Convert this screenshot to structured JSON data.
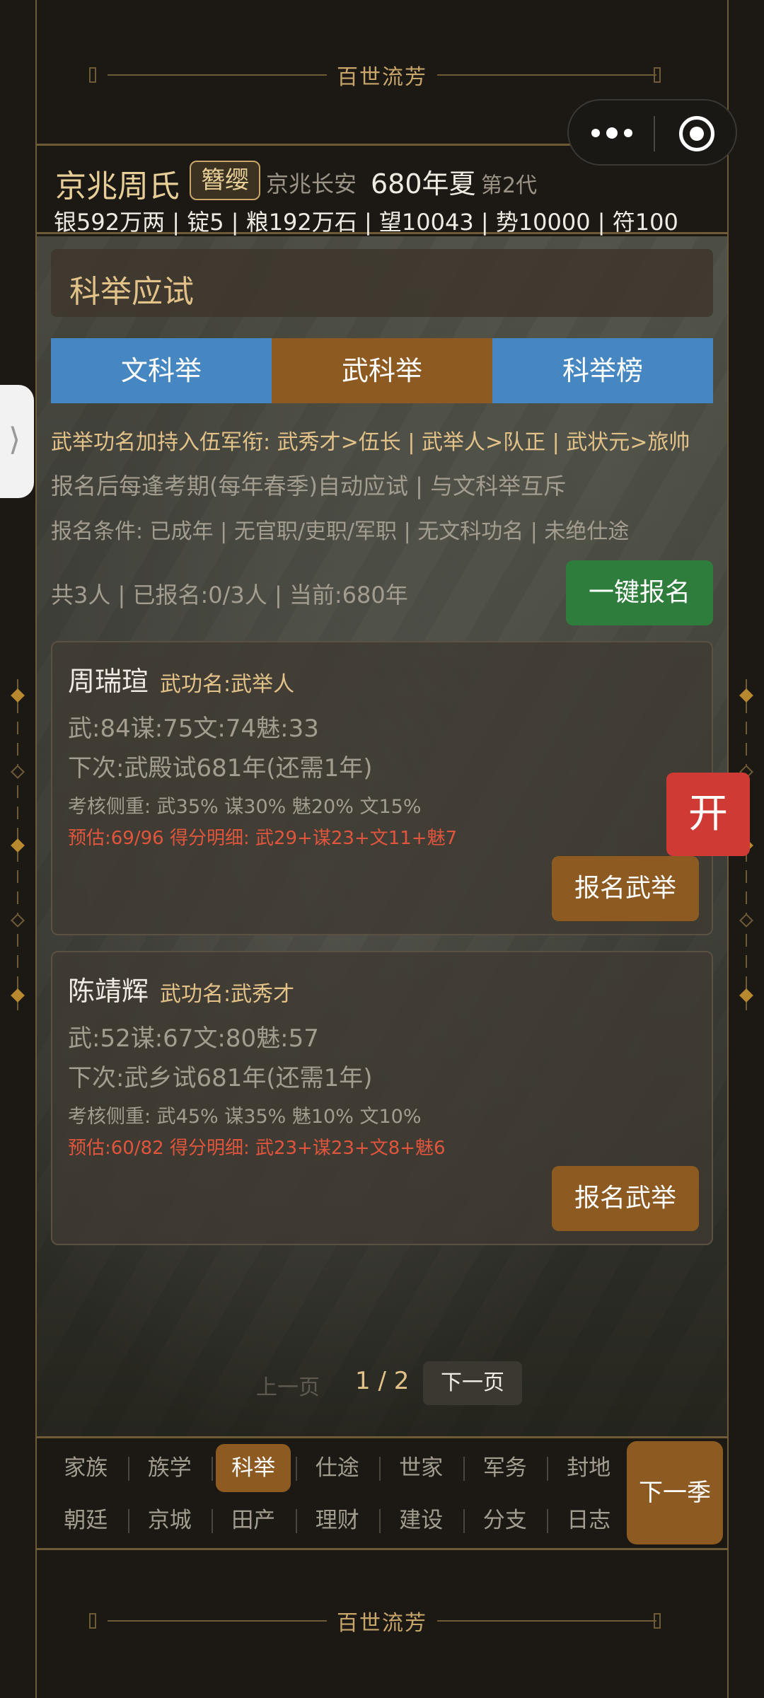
{
  "app": {
    "title": "百世流芳"
  },
  "header": {
    "family_name": "京兆周氏",
    "rank_badge": "簪缨",
    "location": "京兆长安",
    "year": "680年夏",
    "generation": "第2代",
    "resources": "银592万两 | 锭5 | 粮192万石 | 望10043 | 势10000 | 符100"
  },
  "section": {
    "title": "科举应试",
    "tabs": [
      {
        "label": "文科举",
        "active": false
      },
      {
        "label": "武科举",
        "active": true
      },
      {
        "label": "科举榜",
        "active": false
      }
    ],
    "info_gold": "武举功名加持入伍军衔: 武秀才>伍长 | 武举人>队正 | 武状元>旅帅",
    "info_auto": "报名后每逢考期(每年春季)自动应试 | 与文科举互斥",
    "info_condition": "报名条件: 已成年 | 无官职/吏职/军职 | 无文科功名 | 未绝仕途",
    "count": "共3人 | 已报名:0/3人 | 当前:680年",
    "enroll_all": "一键报名"
  },
  "candidates": [
    {
      "name": "周瑞瑄",
      "title": "武功名:武举人",
      "stats": "武:84谋:75文:74魅:33",
      "next_exam": "下次:武殿试681年(还需1年)",
      "weights": "考核侧重: 武35% 谋30% 魅20% 文15%",
      "estimate": "预估:69/96  得分明细: 武29+谋23+文11+魅7",
      "signup": "报名武举"
    },
    {
      "name": "陈靖辉",
      "title": "武功名:武秀才",
      "stats": "武:52谋:67文:80魅:57",
      "next_exam": "下次:武乡试681年(还需1年)",
      "weights": "考核侧重: 武45% 谋35% 魅10% 文10%",
      "estimate": "预估:60/82  得分明细: 武23+谋23+文8+魅6",
      "signup": "报名武举"
    }
  ],
  "pager": {
    "prev": "上一页",
    "page": "1 / 2",
    "next": "下一页"
  },
  "nav": {
    "row1": [
      "家族",
      "族学",
      "科举",
      "仕途",
      "世家",
      "军务",
      "封地"
    ],
    "row2": [
      "朝廷",
      "京城",
      "田产",
      "理财",
      "建设",
      "分支",
      "日志"
    ],
    "active": "科举",
    "next_season": "下一季"
  },
  "floating": {
    "side_tab_icon": "⟩",
    "open_button": "开"
  },
  "icons": {
    "more": "more-dots-icon",
    "close": "target-circle-icon"
  },
  "colors": {
    "accent_gold": "#e3c28a",
    "tab_blue": "#4687c2",
    "tab_brown": "#8d5a22",
    "green": "#2f7d3c",
    "red": "#d03a35"
  }
}
